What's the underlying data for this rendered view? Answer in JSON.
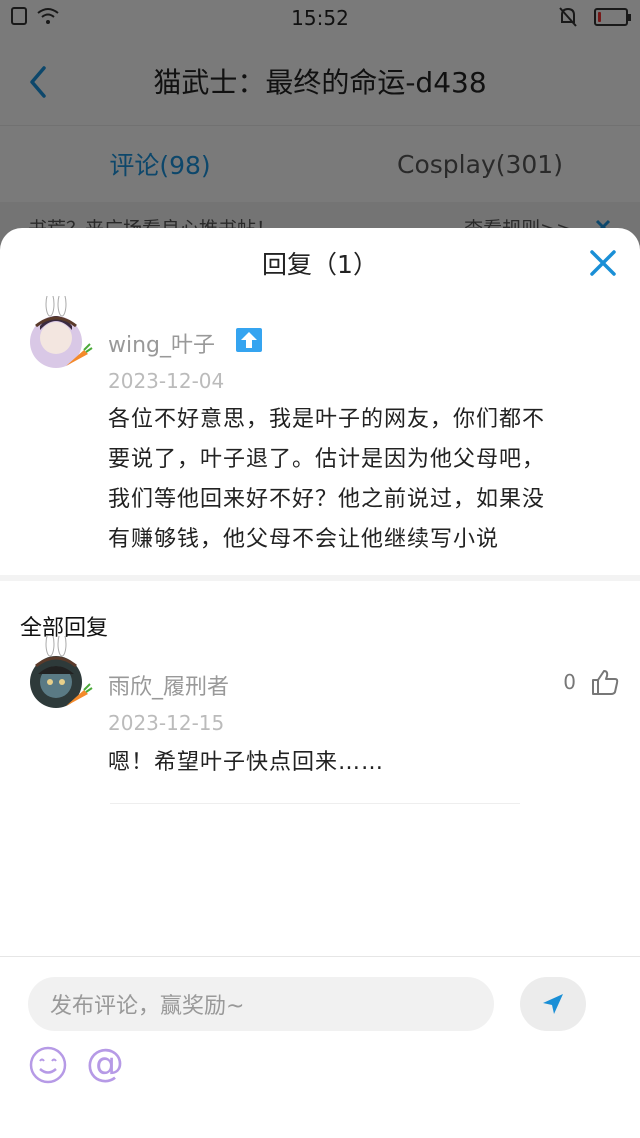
{
  "status": {
    "time": "15:52",
    "battery_level": 0.12
  },
  "nav": {
    "title": "猫武士：最终的命运-d438",
    "back_icon": "chevron-left-icon"
  },
  "tabs": [
    {
      "label": "评论(98)",
      "active": true
    },
    {
      "label": "Cosplay(301)",
      "active": false
    }
  ],
  "notice": {
    "text": "书荒？来广场看良心推书帖！",
    "link": "查看规则>>"
  },
  "sheet": {
    "title": "回复（1）",
    "main_comment": {
      "username": "wing_叶子",
      "date": "2023-12-04",
      "lines": [
        "各位不好意思，我是叶子的网友，你们都不",
        "要说了，叶子退了。估计是因为他父母吧，",
        "我们等他回来好不好？他之前说过，如果没",
        "有赚够钱，他父母不会让他继续写小说"
      ]
    },
    "replies_title": "全部回复",
    "replies": [
      {
        "username": "雨欣_履刑者",
        "date": "2023-12-15",
        "text": "嗯！希望叶子快点回来……",
        "likes": "0"
      }
    ]
  },
  "input": {
    "placeholder": "发布评论，赢奖励~",
    "at_label": "@"
  },
  "colors": {
    "accent": "#1a8fd6",
    "badge": "#35a4f0",
    "emoji": "#b69ae6"
  }
}
